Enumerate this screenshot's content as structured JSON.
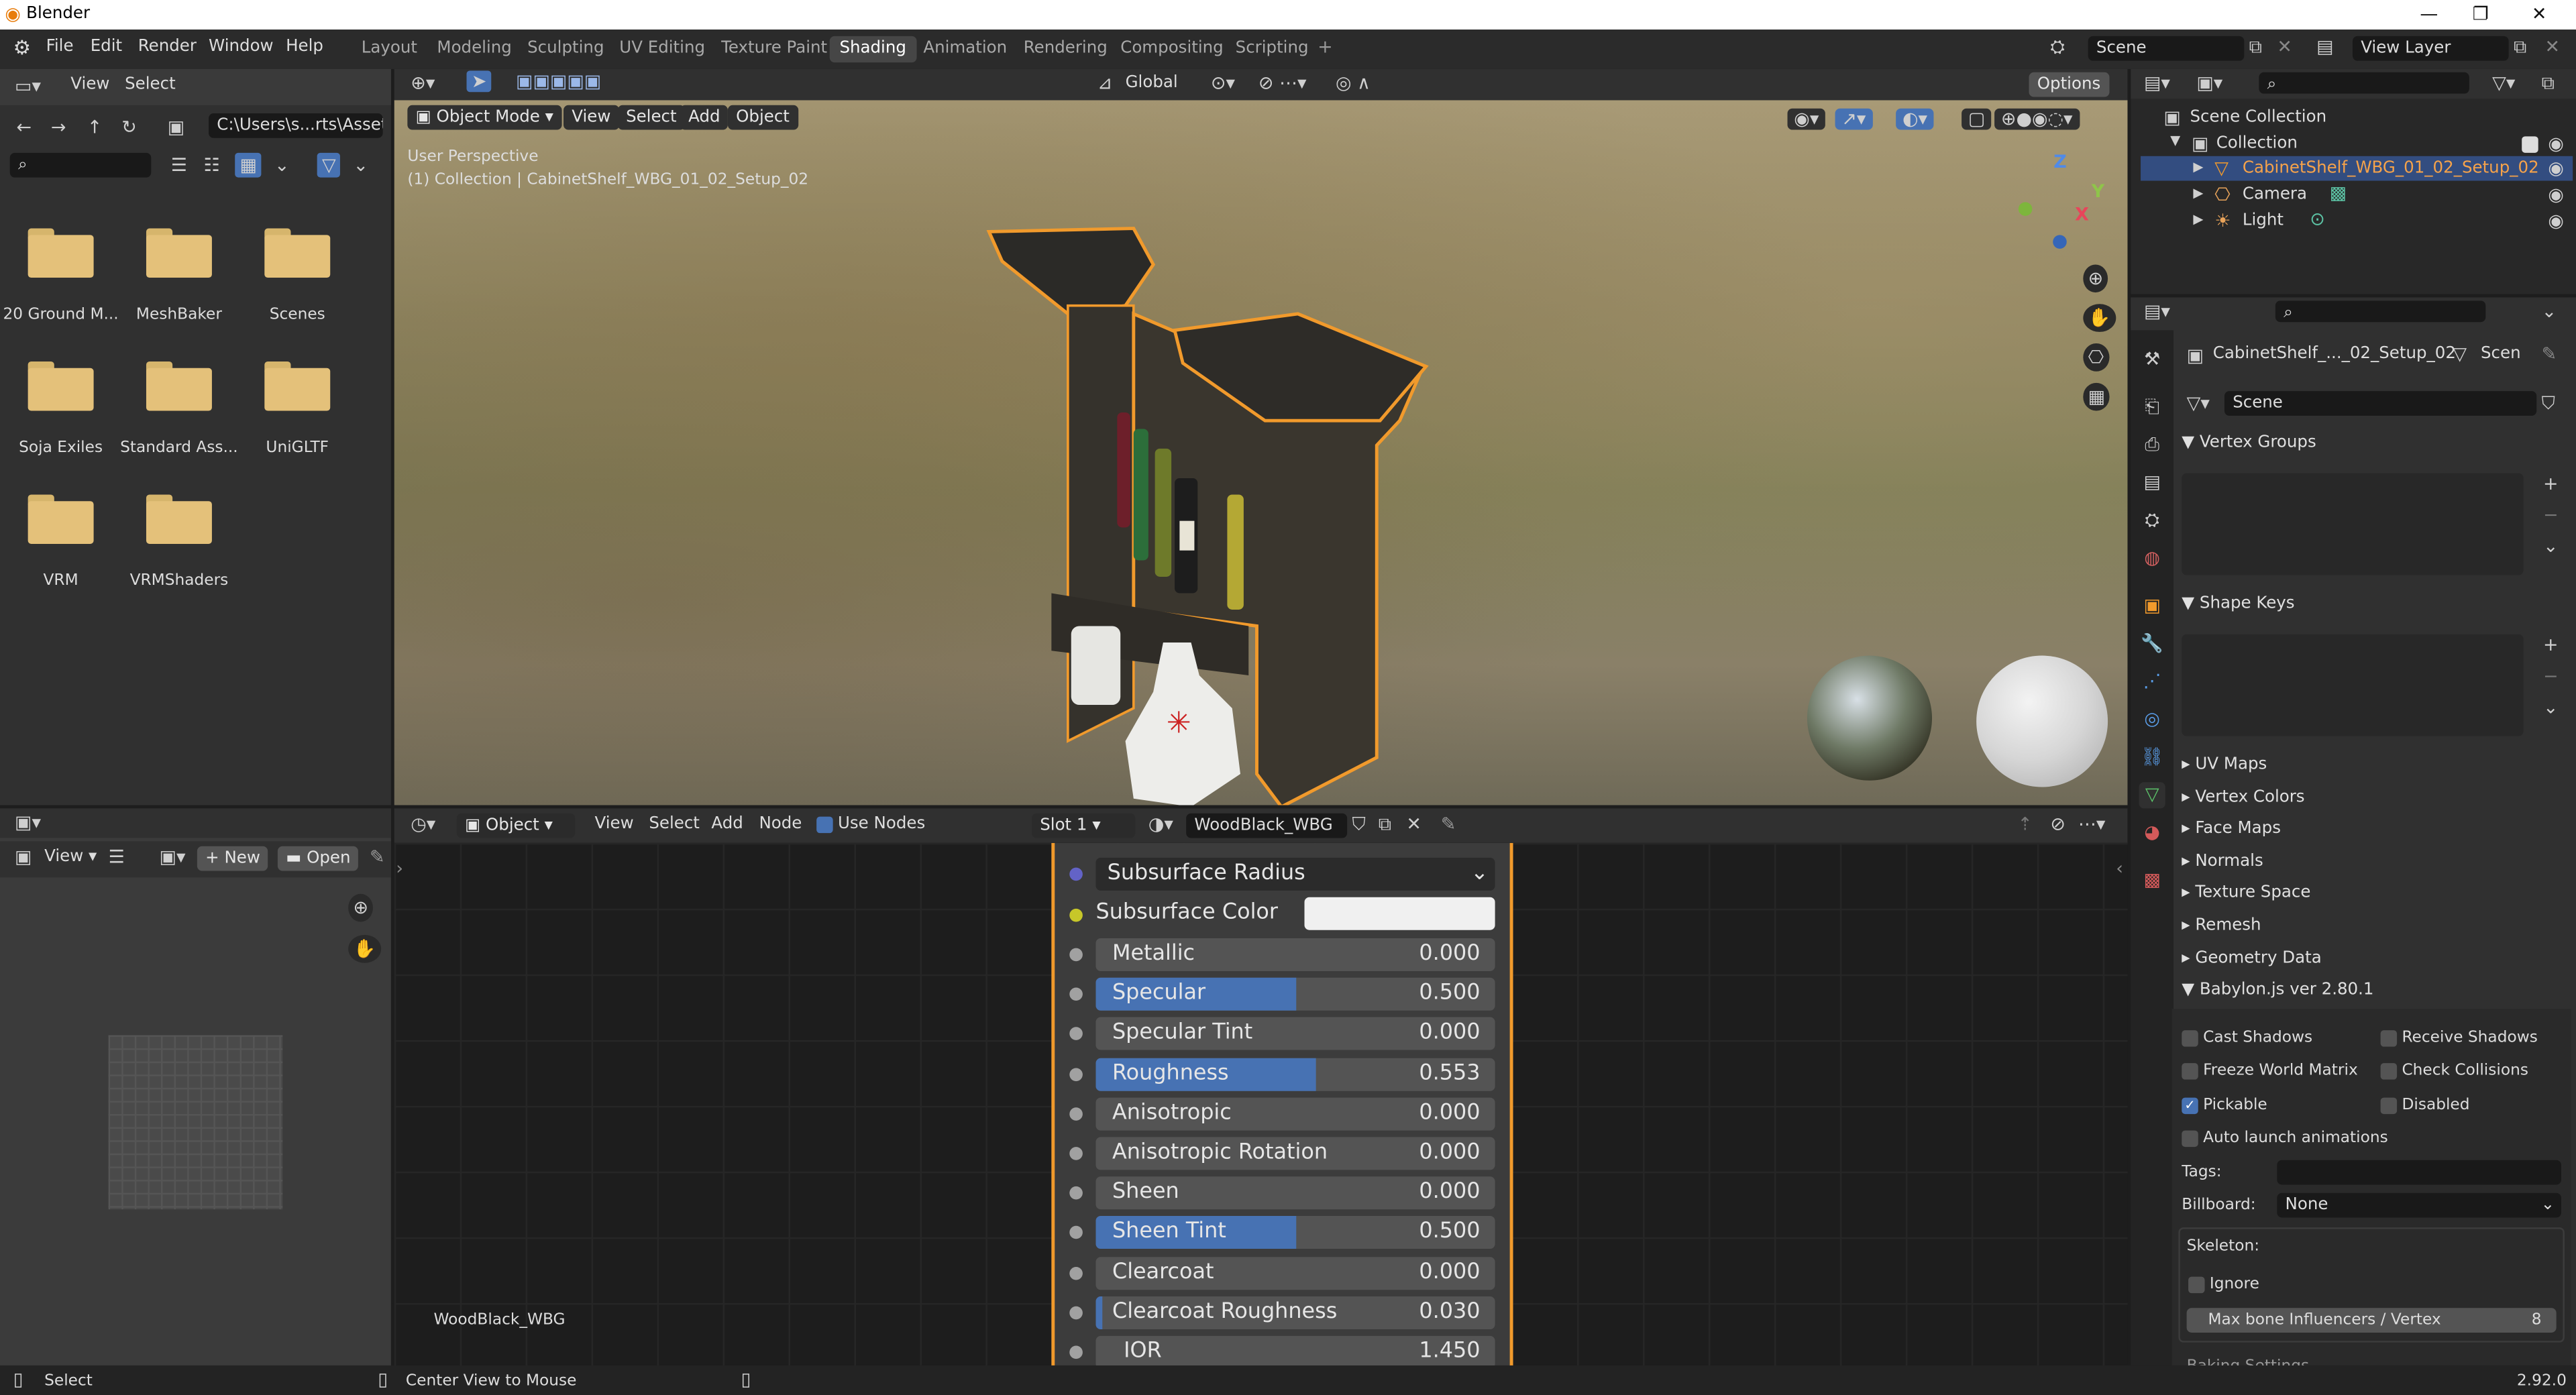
{
  "app": {
    "title": "Blender",
    "version": "2.92.0"
  },
  "menu": [
    "File",
    "Edit",
    "Render",
    "Window",
    "Help"
  ],
  "workspaces": [
    "Layout",
    "Modeling",
    "Sculpting",
    "UV Editing",
    "Texture Paint",
    "Shading",
    "Animation",
    "Rendering",
    "Compositing",
    "Scripting"
  ],
  "scene": "Scene",
  "view_layer": "View Layer",
  "file_browser": {
    "view": "View",
    "select": "Select",
    "path": "C:\\Users\\s...rts\\Assets\\",
    "folders": [
      "20 Ground M...",
      "MeshBaker",
      "Scenes",
      "Soja Exiles",
      "Standard Ass...",
      "UniGLTF",
      "VRM",
      "VRMShaders"
    ]
  },
  "viewport": {
    "mode": "Object Mode",
    "menus": [
      "View",
      "Select",
      "Add",
      "Object"
    ],
    "transform": "Global",
    "options": "Options",
    "info1": "User Perspective",
    "info2": "(1) Collection | CabinetShelf_WBG_01_02_Setup_02"
  },
  "image_editor": {
    "view": "View",
    "new": "New",
    "open": "Open",
    "image_name": "WoodBlack_WBG"
  },
  "node_editor": {
    "type": "Object",
    "menus": [
      "View",
      "Select",
      "Add",
      "Node"
    ],
    "use_nodes": "Use Nodes",
    "slot": "Slot 1",
    "material": "WoodBlack_WBG",
    "subsurface_radius": "Subsurface Radius",
    "subsurface_color": "Subsurface Color",
    "rows": [
      {
        "label": "Metallic",
        "value": "0.000",
        "fill": 0
      },
      {
        "label": "Specular",
        "value": "0.500",
        "fill": 0.5
      },
      {
        "label": "Specular Tint",
        "value": "0.000",
        "fill": 0
      },
      {
        "label": "Roughness",
        "value": "0.553",
        "fill": 0.553
      },
      {
        "label": "Anisotropic",
        "value": "0.000",
        "fill": 0
      },
      {
        "label": "Anisotropic Rotation",
        "value": "0.000",
        "fill": 0
      },
      {
        "label": "Sheen",
        "value": "0.000",
        "fill": 0
      },
      {
        "label": "Sheen Tint",
        "value": "0.500",
        "fill": 0.5
      },
      {
        "label": "Clearcoat",
        "value": "0.000",
        "fill": 0
      },
      {
        "label": "Clearcoat Roughness",
        "value": "0.030",
        "fill": 0.03
      },
      {
        "label": "IOR",
        "value": "1.450",
        "fill": 0
      }
    ]
  },
  "outliner": {
    "scene_collection": "Scene Collection",
    "collection": "Collection",
    "items": [
      "CabinetShelf_WBG_01_02_Setup_02",
      "Camera",
      "Light"
    ]
  },
  "properties": {
    "object_name": "CabinetShelf_..._02_Setup_02",
    "scene_short": "Scen",
    "data_name": "Scene",
    "sections": {
      "vertex_groups": "Vertex Groups",
      "shape_keys": "Shape Keys",
      "collapsed": [
        "UV Maps",
        "Vertex Colors",
        "Face Maps",
        "Normals",
        "Texture Space",
        "Remesh",
        "Geometry Data"
      ],
      "babylon": "Babylon.js ver 2.80.1"
    },
    "checks": [
      {
        "label": "Cast Shadows",
        "on": false
      },
      {
        "label": "Receive Shadows",
        "on": false
      },
      {
        "label": "Freeze World Matrix",
        "on": false
      },
      {
        "label": "Check Collisions",
        "on": false
      },
      {
        "label": "Pickable",
        "on": true
      },
      {
        "label": "Disabled",
        "on": false
      },
      {
        "label": "Auto launch animations",
        "on": false
      }
    ],
    "tags_label": "Tags:",
    "billboard_label": "Billboard:",
    "billboard_value": "None",
    "skeleton_label": "Skeleton:",
    "ignore_label": "Ignore",
    "max_bone_label": "Max bone Influencers / Vertex",
    "max_bone_value": "8",
    "baking": "Baking Settings"
  },
  "status": {
    "select": "Select",
    "center": "Center View to Mouse"
  }
}
